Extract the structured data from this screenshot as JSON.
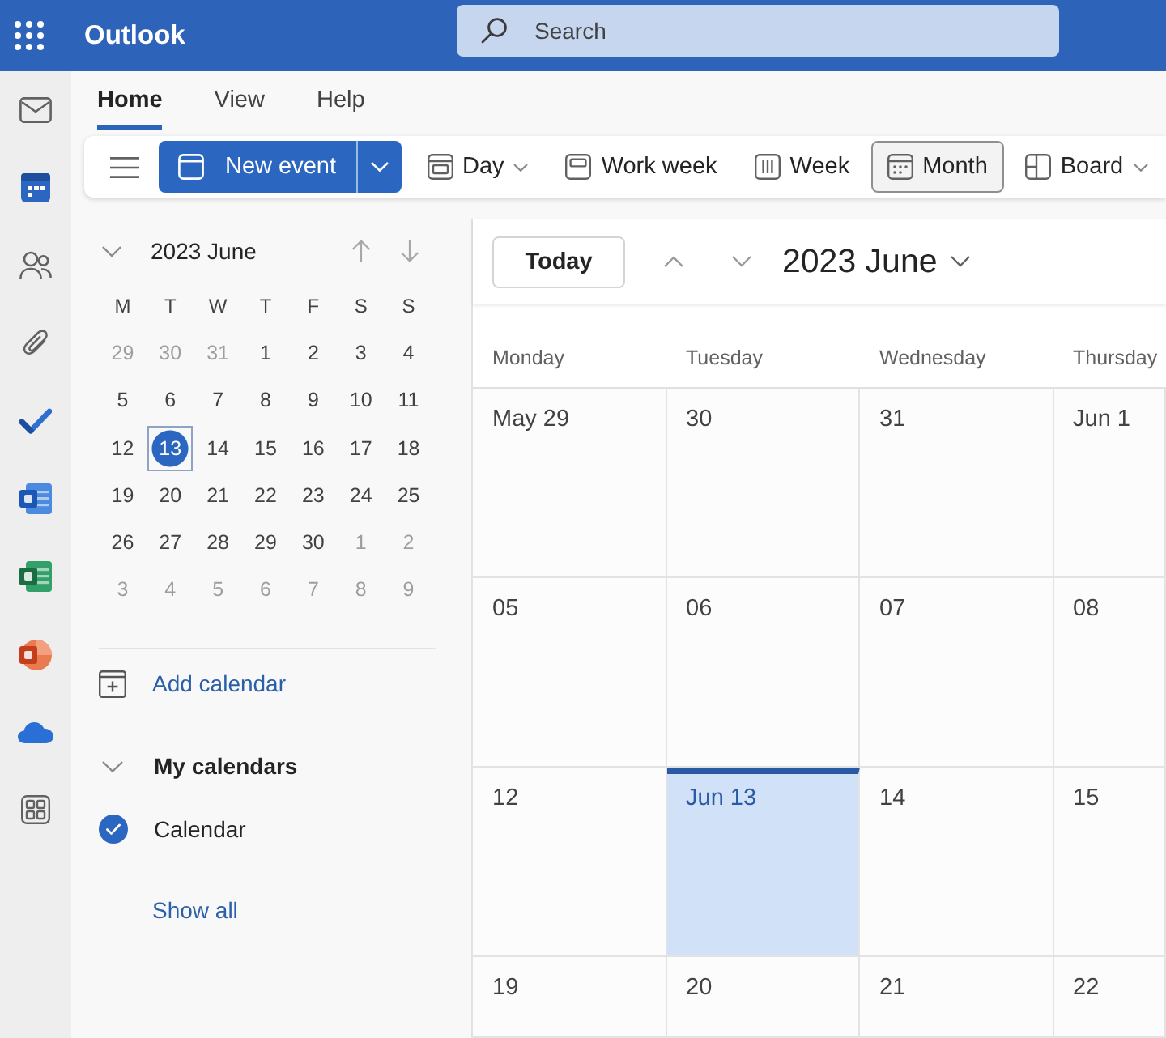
{
  "top_bar": {
    "app_name": "Outlook",
    "search": {
      "placeholder": "Search"
    }
  },
  "rail": {
    "items": [
      {
        "kind": "mail",
        "selected": false
      },
      {
        "kind": "calendar",
        "selected": true
      },
      {
        "kind": "people",
        "selected": false
      },
      {
        "kind": "files",
        "selected": false
      },
      {
        "kind": "tasks",
        "selected": false
      },
      {
        "kind": "document",
        "selected": false
      },
      {
        "kind": "spreadsheet",
        "selected": false
      },
      {
        "kind": "presentation",
        "selected": false
      },
      {
        "kind": "cloud",
        "selected": false
      },
      {
        "kind": "apps",
        "selected": false
      }
    ]
  },
  "ribbon": {
    "tabs": [
      {
        "label": "Home",
        "selected": true
      },
      {
        "label": "View",
        "selected": false
      },
      {
        "label": "Help",
        "selected": false
      }
    ],
    "new_event": {
      "label": "New event"
    },
    "views": [
      {
        "kind": "day",
        "label": "Day",
        "has_menu": true,
        "selected": false
      },
      {
        "kind": "work_week",
        "label": "Work week",
        "has_menu": false,
        "selected": false
      },
      {
        "kind": "week",
        "label": "Week",
        "has_menu": false,
        "selected": false
      },
      {
        "kind": "month",
        "label": "Month",
        "has_menu": false,
        "selected": true
      },
      {
        "kind": "board",
        "label": "Board",
        "has_menu": true,
        "selected": false
      }
    ]
  },
  "mini_calendar": {
    "title": "2023 June",
    "weekdays": [
      "M",
      "T",
      "W",
      "T",
      "F",
      "S",
      "S"
    ],
    "weeks": [
      [
        {
          "day": "29",
          "in_month": false,
          "selected": false
        },
        {
          "day": "30",
          "in_month": false,
          "selected": false
        },
        {
          "day": "31",
          "in_month": false,
          "selected": false
        },
        {
          "day": "1",
          "in_month": true,
          "selected": false
        },
        {
          "day": "2",
          "in_month": true,
          "selected": false
        },
        {
          "day": "3",
          "in_month": true,
          "selected": false
        },
        {
          "day": "4",
          "in_month": true,
          "selected": false
        }
      ],
      [
        {
          "day": "5",
          "in_month": true,
          "selected": false
        },
        {
          "day": "6",
          "in_month": true,
          "selected": false
        },
        {
          "day": "7",
          "in_month": true,
          "selected": false
        },
        {
          "day": "8",
          "in_month": true,
          "selected": false
        },
        {
          "day": "9",
          "in_month": true,
          "selected": false
        },
        {
          "day": "10",
          "in_month": true,
          "selected": false
        },
        {
          "day": "11",
          "in_month": true,
          "selected": false
        }
      ],
      [
        {
          "day": "12",
          "in_month": true,
          "selected": false
        },
        {
          "day": "13",
          "in_month": true,
          "selected": true
        },
        {
          "day": "14",
          "in_month": true,
          "selected": false
        },
        {
          "day": "15",
          "in_month": true,
          "selected": false
        },
        {
          "day": "16",
          "in_month": true,
          "selected": false
        },
        {
          "day": "17",
          "in_month": true,
          "selected": false
        },
        {
          "day": "18",
          "in_month": true,
          "selected": false
        }
      ],
      [
        {
          "day": "19",
          "in_month": true,
          "selected": false
        },
        {
          "day": "20",
          "in_month": true,
          "selected": false
        },
        {
          "day": "21",
          "in_month": true,
          "selected": false
        },
        {
          "day": "22",
          "in_month": true,
          "selected": false
        },
        {
          "day": "23",
          "in_month": true,
          "selected": false
        },
        {
          "day": "24",
          "in_month": true,
          "selected": false
        },
        {
          "day": "25",
          "in_month": true,
          "selected": false
        }
      ],
      [
        {
          "day": "26",
          "in_month": true,
          "selected": false
        },
        {
          "day": "27",
          "in_month": true,
          "selected": false
        },
        {
          "day": "28",
          "in_month": true,
          "selected": false
        },
        {
          "day": "29",
          "in_month": true,
          "selected": false
        },
        {
          "day": "30",
          "in_month": true,
          "selected": false
        },
        {
          "day": "1",
          "in_month": false,
          "selected": false
        },
        {
          "day": "2",
          "in_month": false,
          "selected": false
        }
      ],
      [
        {
          "day": "3",
          "in_month": false,
          "selected": false
        },
        {
          "day": "4",
          "in_month": false,
          "selected": false
        },
        {
          "day": "5",
          "in_month": false,
          "selected": false
        },
        {
          "day": "6",
          "in_month": false,
          "selected": false
        },
        {
          "day": "7",
          "in_month": false,
          "selected": false
        },
        {
          "day": "8",
          "in_month": false,
          "selected": false
        },
        {
          "day": "9",
          "in_month": false,
          "selected": false
        }
      ]
    ]
  },
  "side": {
    "add_calendar": "Add calendar",
    "group": {
      "title": "My calendars",
      "expanded": true,
      "calendars": [
        {
          "name": "Calendar",
          "checked": true
        }
      ]
    },
    "show_all": "Show all"
  },
  "calendar": {
    "today_button": "Today",
    "title": "2023 June",
    "columns": [
      "Monday",
      "Tuesday",
      "Wednesday",
      "Thursday"
    ],
    "weeks": [
      [
        {
          "label": "May 29",
          "today": false
        },
        {
          "label": "30",
          "today": false
        },
        {
          "label": "31",
          "today": false
        },
        {
          "label": "Jun 1",
          "today": false
        }
      ],
      [
        {
          "label": "05",
          "today": false
        },
        {
          "label": "06",
          "today": false
        },
        {
          "label": "07",
          "today": false
        },
        {
          "label": "08",
          "today": false
        }
      ],
      [
        {
          "label": "12",
          "today": false
        },
        {
          "label": "Jun 13",
          "today": true
        },
        {
          "label": "14",
          "today": false
        },
        {
          "label": "15",
          "today": false
        }
      ],
      [
        {
          "label": "19",
          "today": false
        },
        {
          "label": "20",
          "today": false
        },
        {
          "label": "21",
          "today": false
        },
        {
          "label": "22",
          "today": false
        }
      ]
    ]
  }
}
